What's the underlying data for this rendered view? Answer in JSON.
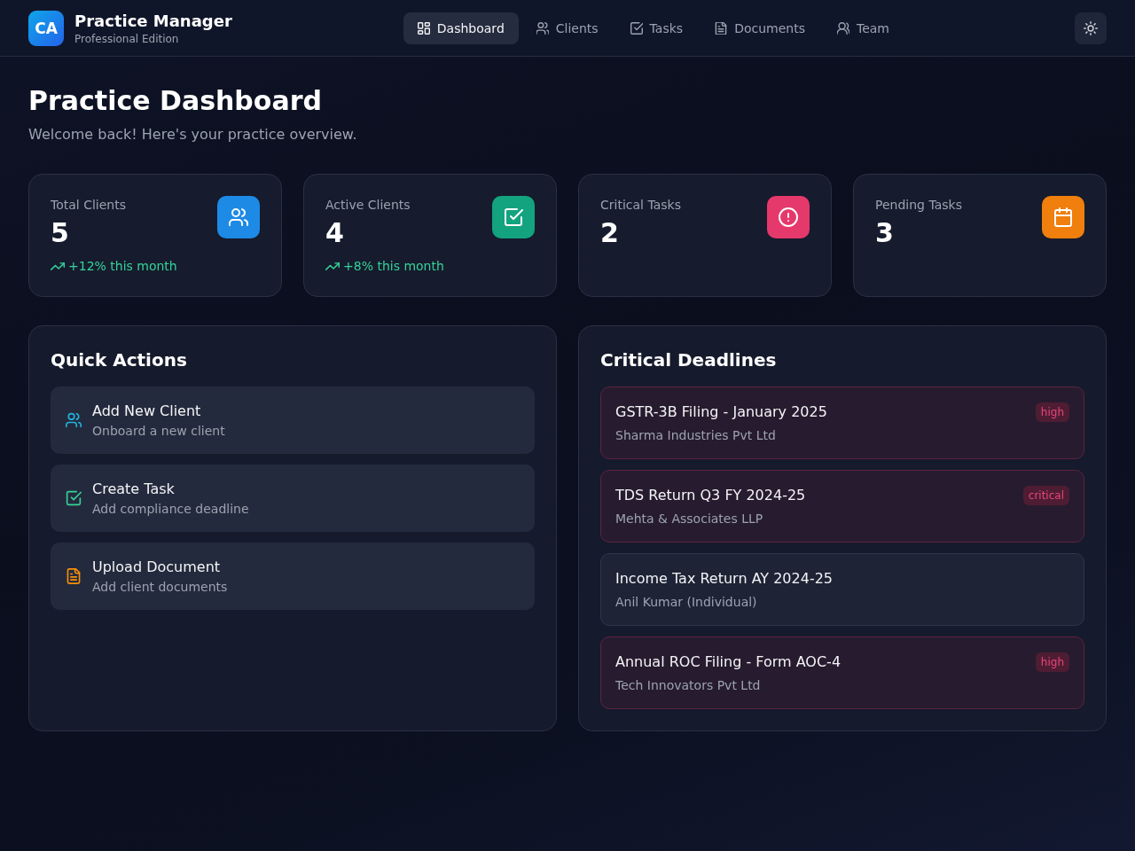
{
  "header": {
    "logo": "CA",
    "title": "Practice Manager",
    "subtitle": "Professional Edition"
  },
  "nav": [
    {
      "label": "Dashboard",
      "selected": true
    },
    {
      "label": "Clients",
      "selected": false
    },
    {
      "label": "Tasks",
      "selected": false
    },
    {
      "label": "Documents",
      "selected": false
    },
    {
      "label": "Team",
      "selected": false
    }
  ],
  "page": {
    "title": "Practice Dashboard",
    "subtitle": "Welcome back! Here's your practice overview."
  },
  "stats": [
    {
      "label": "Total Clients",
      "value": "5",
      "trend": "+12% this month",
      "color": "#1d8ae6"
    },
    {
      "label": "Active Clients",
      "value": "4",
      "trend": "+8% this month",
      "color": "#13a37f"
    },
    {
      "label": "Critical Tasks",
      "value": "2",
      "color": "#e5386b"
    },
    {
      "label": "Pending Tasks",
      "value": "3",
      "color": "#f07f0e"
    }
  ],
  "quick_actions": {
    "title": "Quick Actions",
    "items": [
      {
        "title": "Add New Client",
        "subtitle": "Onboard a new client",
        "color": "#22b2dc"
      },
      {
        "title": "Create Task",
        "subtitle": "Add compliance deadline",
        "color": "#34d399"
      },
      {
        "title": "Upload Document",
        "subtitle": "Add client documents",
        "color": "#f5900b"
      }
    ]
  },
  "deadlines": {
    "title": "Critical Deadlines",
    "items": [
      {
        "title": "GSTR-3B Filing - January 2025",
        "client": "Sharma Industries Pvt Ltd",
        "priority": "high"
      },
      {
        "title": "TDS Return Q3 FY 2024-25",
        "client": "Mehta & Associates LLP",
        "priority": "critical"
      },
      {
        "title": "Income Tax Return AY 2024-25",
        "client": "Anil Kumar (Individual)"
      },
      {
        "title": "Annual ROC Filing - Form AOC-4",
        "client": "Tech Innovators Pvt Ltd",
        "priority": "high"
      }
    ]
  }
}
